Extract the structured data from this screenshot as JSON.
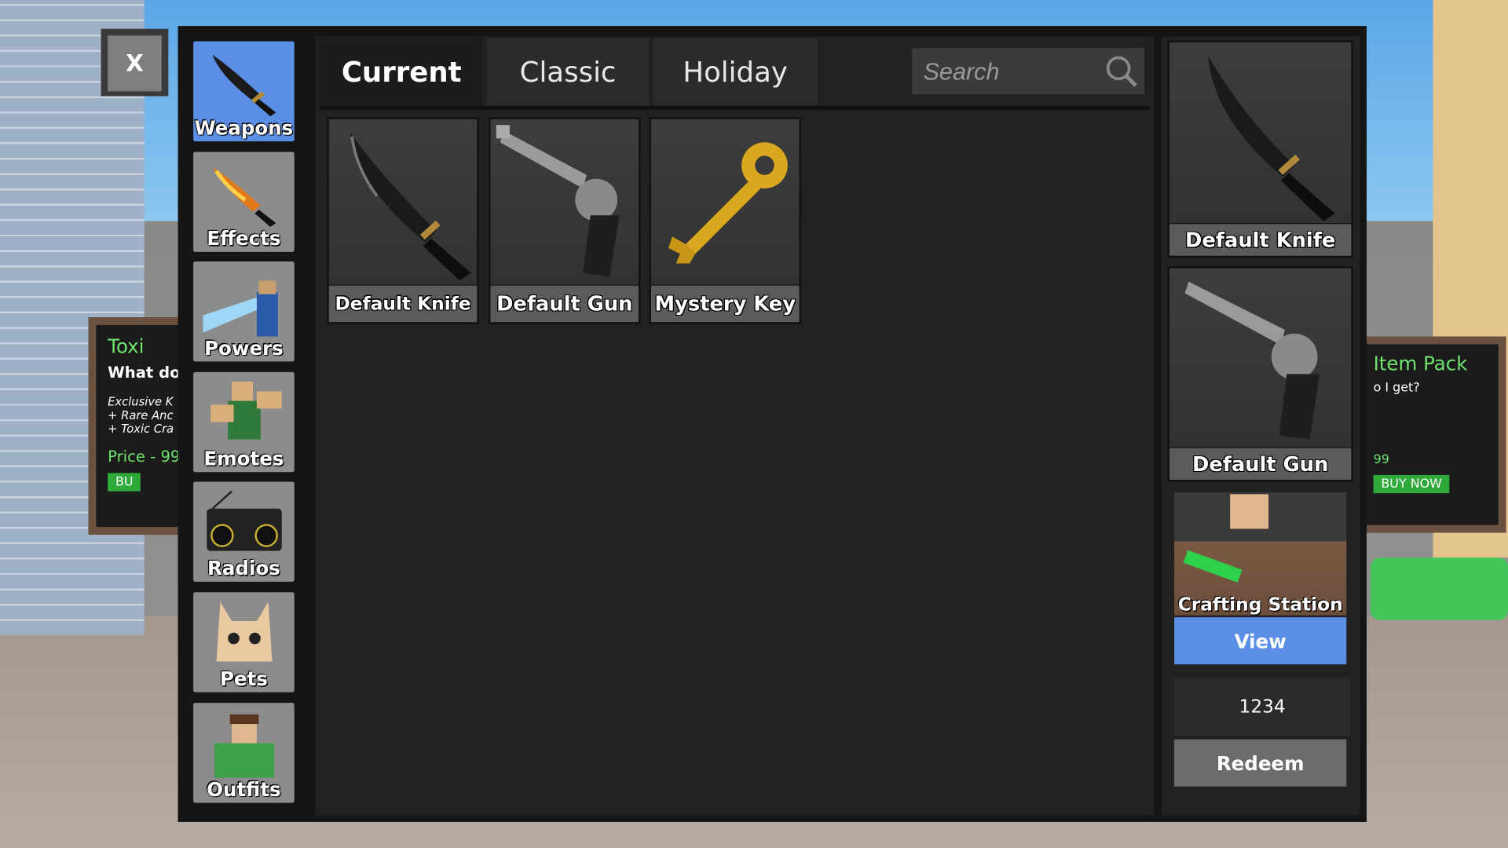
{
  "close_button": {
    "label": "X"
  },
  "sidebar": {
    "items": [
      {
        "label": "Weapons",
        "icon": "knife-icon",
        "selected": true
      },
      {
        "label": "Effects",
        "icon": "flame-knife-icon"
      },
      {
        "label": "Powers",
        "icon": "powers-icon"
      },
      {
        "label": "Emotes",
        "icon": "emote-icon"
      },
      {
        "label": "Radios",
        "icon": "radio-icon"
      },
      {
        "label": "Pets",
        "icon": "pet-icon"
      },
      {
        "label": "Outfits",
        "icon": "outfit-icon"
      }
    ]
  },
  "tabs": [
    {
      "label": "Current",
      "selected": true
    },
    {
      "label": "Classic"
    },
    {
      "label": "Holiday"
    }
  ],
  "search": {
    "placeholder": "Search",
    "value": ""
  },
  "items": [
    {
      "name": "Default Knife",
      "icon": "knife-icon"
    },
    {
      "name": "Default Gun",
      "icon": "revolver-icon"
    },
    {
      "name": "Mystery Key",
      "icon": "key-icon"
    }
  ],
  "equipped": [
    {
      "name": "Default Knife",
      "icon": "knife-icon"
    },
    {
      "name": "Default Gun",
      "icon": "revolver-icon"
    }
  ],
  "crafting": {
    "label": "Crafting Station",
    "view_label": "View"
  },
  "code": {
    "value": "1234",
    "redeem_label": "Redeem"
  },
  "background": {
    "left_sign": {
      "title": "Toxi",
      "line": "What do",
      "list": [
        "Exclusive K",
        "+ Rare Anc",
        "+ Toxic Cra"
      ],
      "price": "Price - 99",
      "buy": "BU"
    },
    "right_sign": {
      "title": "Item Pack",
      "line": "o I get?",
      "price": "99",
      "buy": "BUY NOW"
    }
  },
  "colors": {
    "accent": "#5b8fe6",
    "panel": "#151515",
    "card": "#3a3a3a"
  }
}
